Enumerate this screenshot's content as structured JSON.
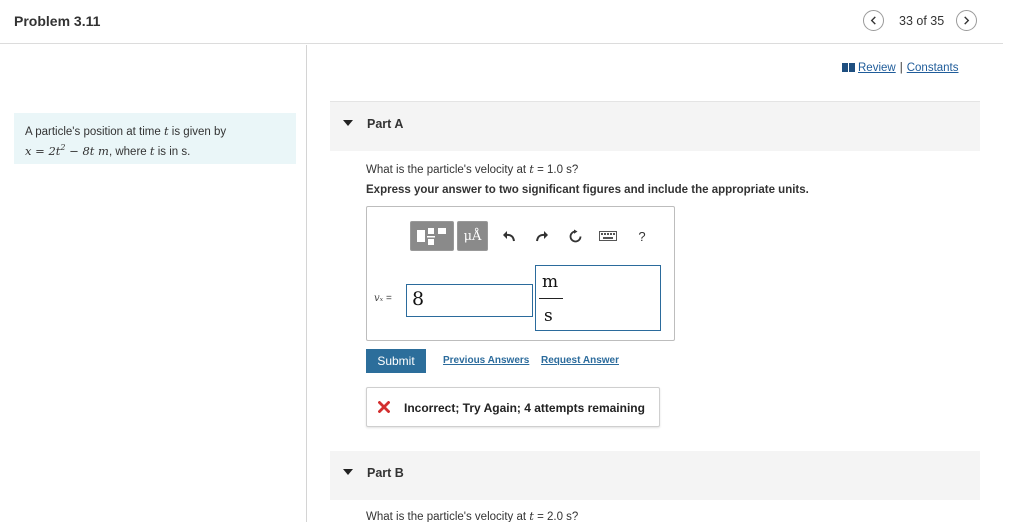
{
  "header": {
    "title": "Problem 3.11",
    "page_counter": "33 of 35",
    "prev_icon": "chevron-left-icon",
    "next_icon": "chevron-right-icon"
  },
  "links": {
    "review": "Review",
    "separator": "|",
    "constants": "Constants"
  },
  "problem": {
    "text_prefix": "A particle's position at time ",
    "t_var": "t",
    "text_mid": " is given by",
    "eq_lhs": "x",
    "eq_eq": " = ",
    "eq_coeff": "2t",
    "eq_exp": "2",
    "eq_rest": " − 8t m",
    "text_after": ", where ",
    "t_var2": "t",
    "text_end": " is in s."
  },
  "part_a": {
    "label": "Part A",
    "question_prefix": "What is the particle's velocity at ",
    "question_var": "t",
    "question_suffix": " = 1.0 s?",
    "instruction": "Express your answer to two significant figures and include the appropriate units.",
    "variable_label": "vₓ",
    "variable_eq": " =",
    "answer_value": "8",
    "unit_numerator": "m",
    "unit_denominator": "s",
    "toolbar": {
      "units_label": "μÅ",
      "help_label": "?"
    },
    "submit_label": "Submit",
    "previous_answers_label": "Previous Answers",
    "request_answer_label": "Request Answer",
    "feedback": "Incorrect; Try Again; 4 attempts remaining"
  },
  "part_b": {
    "label": "Part B",
    "question_prefix": "What is the particle's velocity at ",
    "question_var": "t",
    "question_suffix": " = 2.0 s?"
  },
  "colors": {
    "accent": "#2c6e9b",
    "error": "#d32f2f",
    "problem_bg": "#eaf6f8"
  }
}
